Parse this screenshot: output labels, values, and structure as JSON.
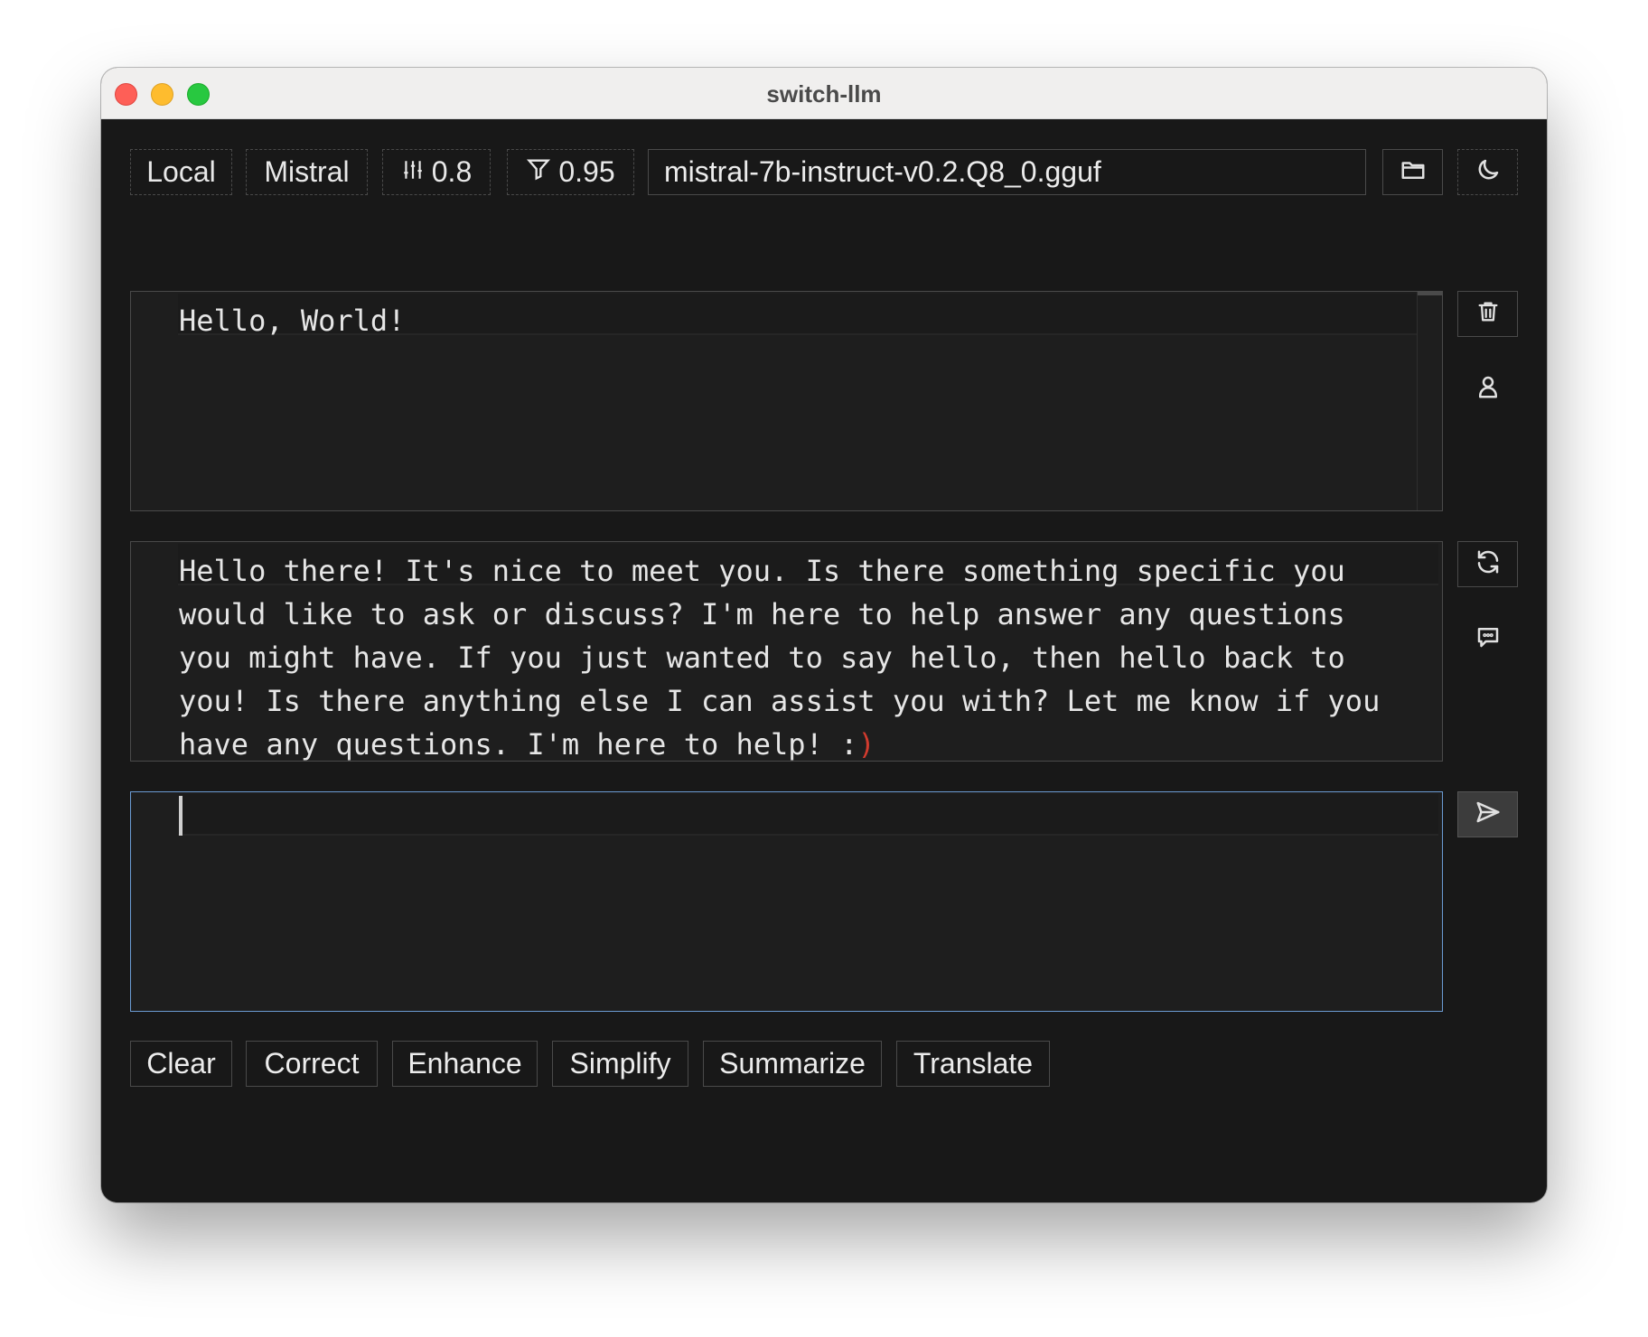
{
  "window": {
    "title": "switch-llm"
  },
  "toolbar": {
    "provider": "Local",
    "family": "Mistral",
    "temperature": "0.8",
    "top_p": "0.95",
    "model_file": "mistral-7b-instruct-v0.2.Q8_0.gguf",
    "icons": [
      "sliders-icon",
      "filter-icon",
      "folder-icon",
      "moon-icon"
    ]
  },
  "user_message": {
    "text": "Hello, World!"
  },
  "assistant_message": {
    "text": "Hello there! It's nice to meet you. Is there something specific you would like to ask or discuss? I'm here to help answer any questions you might have. If you just wanted to say hello, then hello back to you! Is there anything else I can assist you with? Let me know if you have any questions. I'm here to help! :",
    "trailing_char": ")"
  },
  "input": {
    "value": ""
  },
  "actions": [
    "Clear",
    "Correct",
    "Enhance",
    "Simplify",
    "Summarize",
    "Translate"
  ],
  "colors": {
    "focus_border": "#6b9bd2",
    "accent": "#d23b2e",
    "background": "#181818"
  }
}
